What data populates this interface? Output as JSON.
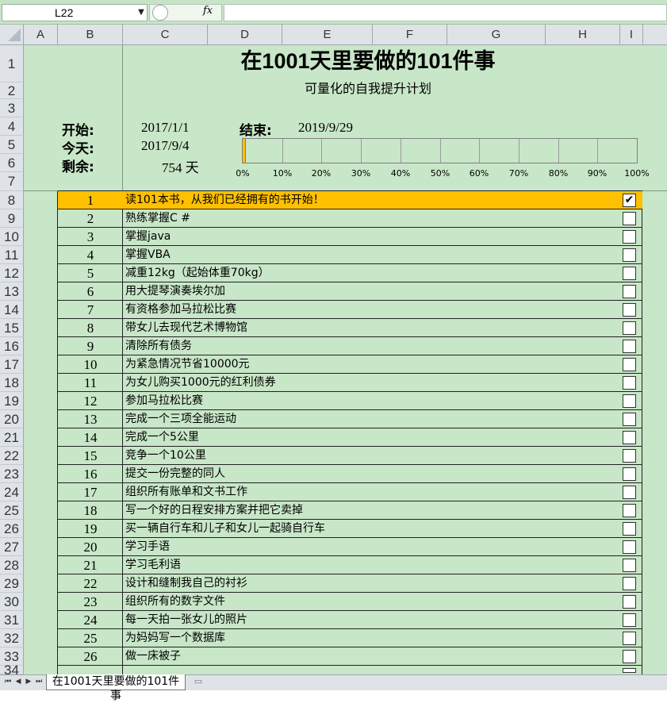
{
  "formula_bar": {
    "name_box": "L22",
    "fx_label": "fx",
    "formula": ""
  },
  "columns": [
    "A",
    "B",
    "C",
    "D",
    "E",
    "F",
    "G",
    "H",
    "I"
  ],
  "rows": [
    "1",
    "2",
    "3",
    "4",
    "5",
    "6",
    "7",
    "8",
    "9",
    "10",
    "11",
    "12",
    "13",
    "14",
    "15",
    "16",
    "17",
    "18",
    "19",
    "20",
    "21",
    "22",
    "23",
    "24",
    "25",
    "26",
    "27",
    "28",
    "29",
    "30",
    "31",
    "32",
    "33",
    "34"
  ],
  "sheet": {
    "title": "在1001天里要做的101件事",
    "subtitle": "可量化的自我提升计划",
    "start_label": "开始:",
    "start_value": "2017/1/1",
    "end_label": "结束:",
    "end_value": "2019/9/29",
    "today_label": "今天:",
    "today_value": "2017/9/4",
    "remain_label": "剩余:",
    "remain_value": "754 天",
    "progress_fraction": 0.009,
    "progress_ticks": [
      "0%",
      "10%",
      "20%",
      "30%",
      "40%",
      "50%",
      "60%",
      "70%",
      "80%",
      "90%",
      "100%"
    ],
    "accent_color": "#ffc000",
    "background_color": "#c8e6c8"
  },
  "tasks": [
    {
      "num": "1",
      "text": "读101本书，从我们已经拥有的书开始！",
      "checked": true,
      "highlight": true
    },
    {
      "num": "2",
      "text": "熟练掌握C #",
      "checked": false
    },
    {
      "num": "3",
      "text": "掌握java",
      "checked": false
    },
    {
      "num": "4",
      "text": "掌握VBA",
      "checked": false
    },
    {
      "num": "5",
      "text": "减重12kg（起始体重70kg）",
      "checked": false
    },
    {
      "num": "6",
      "text": "用大提琴演奏埃尔加",
      "checked": false
    },
    {
      "num": "7",
      "text": "有资格参加马拉松比赛",
      "checked": false
    },
    {
      "num": "8",
      "text": "带女儿去现代艺术博物馆",
      "checked": false
    },
    {
      "num": "9",
      "text": "清除所有债务",
      "checked": false
    },
    {
      "num": "10",
      "text": "为紧急情况节省10000元",
      "checked": false
    },
    {
      "num": "11",
      "text": "为女儿购买1000元的红利债券",
      "checked": false
    },
    {
      "num": "12",
      "text": "参加马拉松比赛",
      "checked": false
    },
    {
      "num": "13",
      "text": "完成一个三项全能运动",
      "checked": false
    },
    {
      "num": "14",
      "text": "完成一个5公里",
      "checked": false
    },
    {
      "num": "15",
      "text": "竞争一个10公里",
      "checked": false
    },
    {
      "num": "16",
      "text": "提交一份完整的同人",
      "checked": false
    },
    {
      "num": "17",
      "text": "组织所有账单和文书工作",
      "checked": false
    },
    {
      "num": "18",
      "text": "写一个好的日程安排方案并把它卖掉",
      "checked": false
    },
    {
      "num": "19",
      "text": "买一辆自行车和儿子和女儿一起骑自行车",
      "checked": false
    },
    {
      "num": "20",
      "text": "学习手语",
      "checked": false
    },
    {
      "num": "21",
      "text": "学习毛利语",
      "checked": false
    },
    {
      "num": "22",
      "text": "设计和缝制我自己的衬衫",
      "checked": false
    },
    {
      "num": "23",
      "text": "组织所有的数字文件",
      "checked": false
    },
    {
      "num": "24",
      "text": "每一天拍一张女儿的照片",
      "checked": false
    },
    {
      "num": "25",
      "text": "为妈妈写一个数据库",
      "checked": false
    },
    {
      "num": "26",
      "text": "做一床被子",
      "checked": false
    }
  ],
  "tab_bar": {
    "sheet_tab": "在1001天里要做的101件事",
    "nav": [
      "⏮",
      "◀",
      "▶",
      "⏭"
    ]
  }
}
